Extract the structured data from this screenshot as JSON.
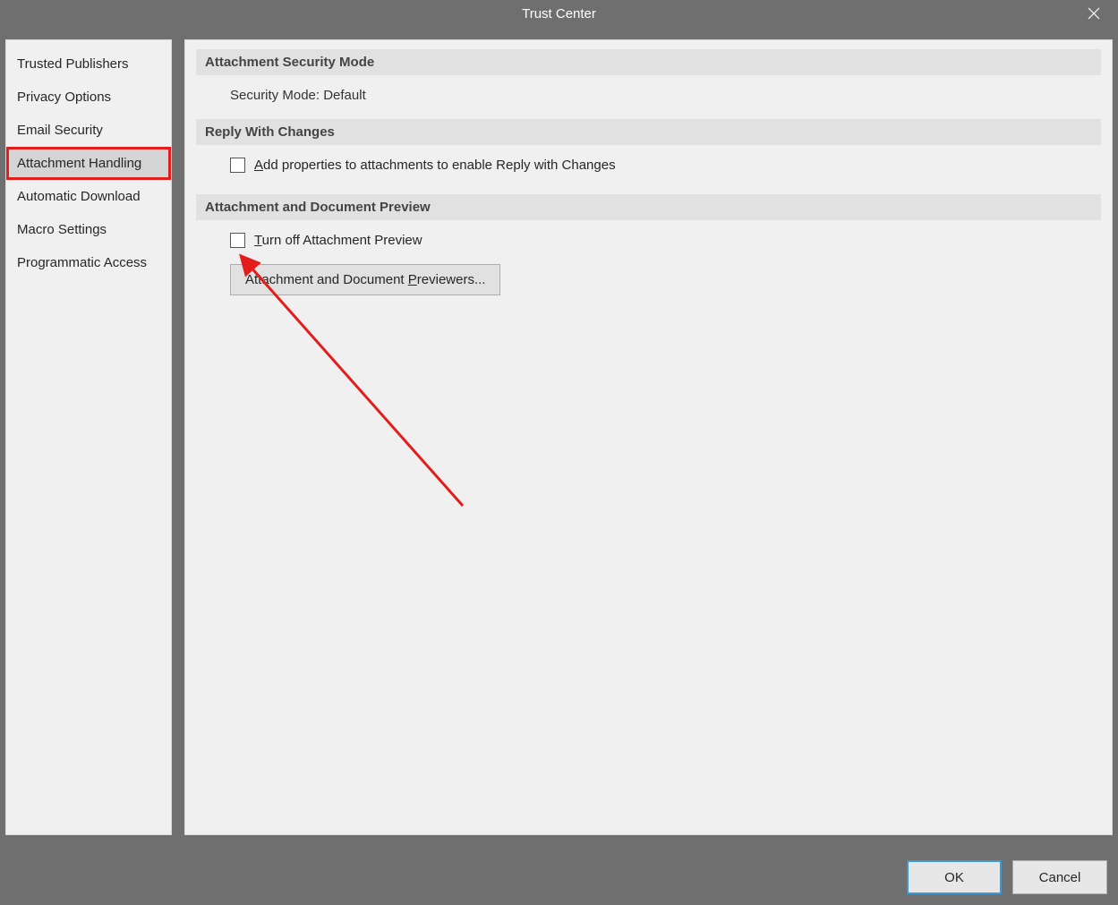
{
  "titlebar": {
    "title": "Trust Center"
  },
  "sidebar": {
    "items": [
      {
        "label": "Trusted Publishers"
      },
      {
        "label": "Privacy Options"
      },
      {
        "label": "Email Security"
      },
      {
        "label": "Attachment Handling"
      },
      {
        "label": "Automatic Download"
      },
      {
        "label": "Macro Settings"
      },
      {
        "label": "Programmatic Access"
      }
    ]
  },
  "sections": {
    "attachment_security": {
      "header": "Attachment Security Mode",
      "line": "Security Mode: Default"
    },
    "reply_changes": {
      "header": "Reply With Changes",
      "checkbox_label": "Add properties to attachments to enable Reply with Changes"
    },
    "preview": {
      "header": "Attachment and Document Preview",
      "checkbox_label": "Turn off Attachment Preview",
      "button_label": "Attachment and Document Previewers..."
    }
  },
  "footer": {
    "ok": "OK",
    "cancel": "Cancel"
  }
}
